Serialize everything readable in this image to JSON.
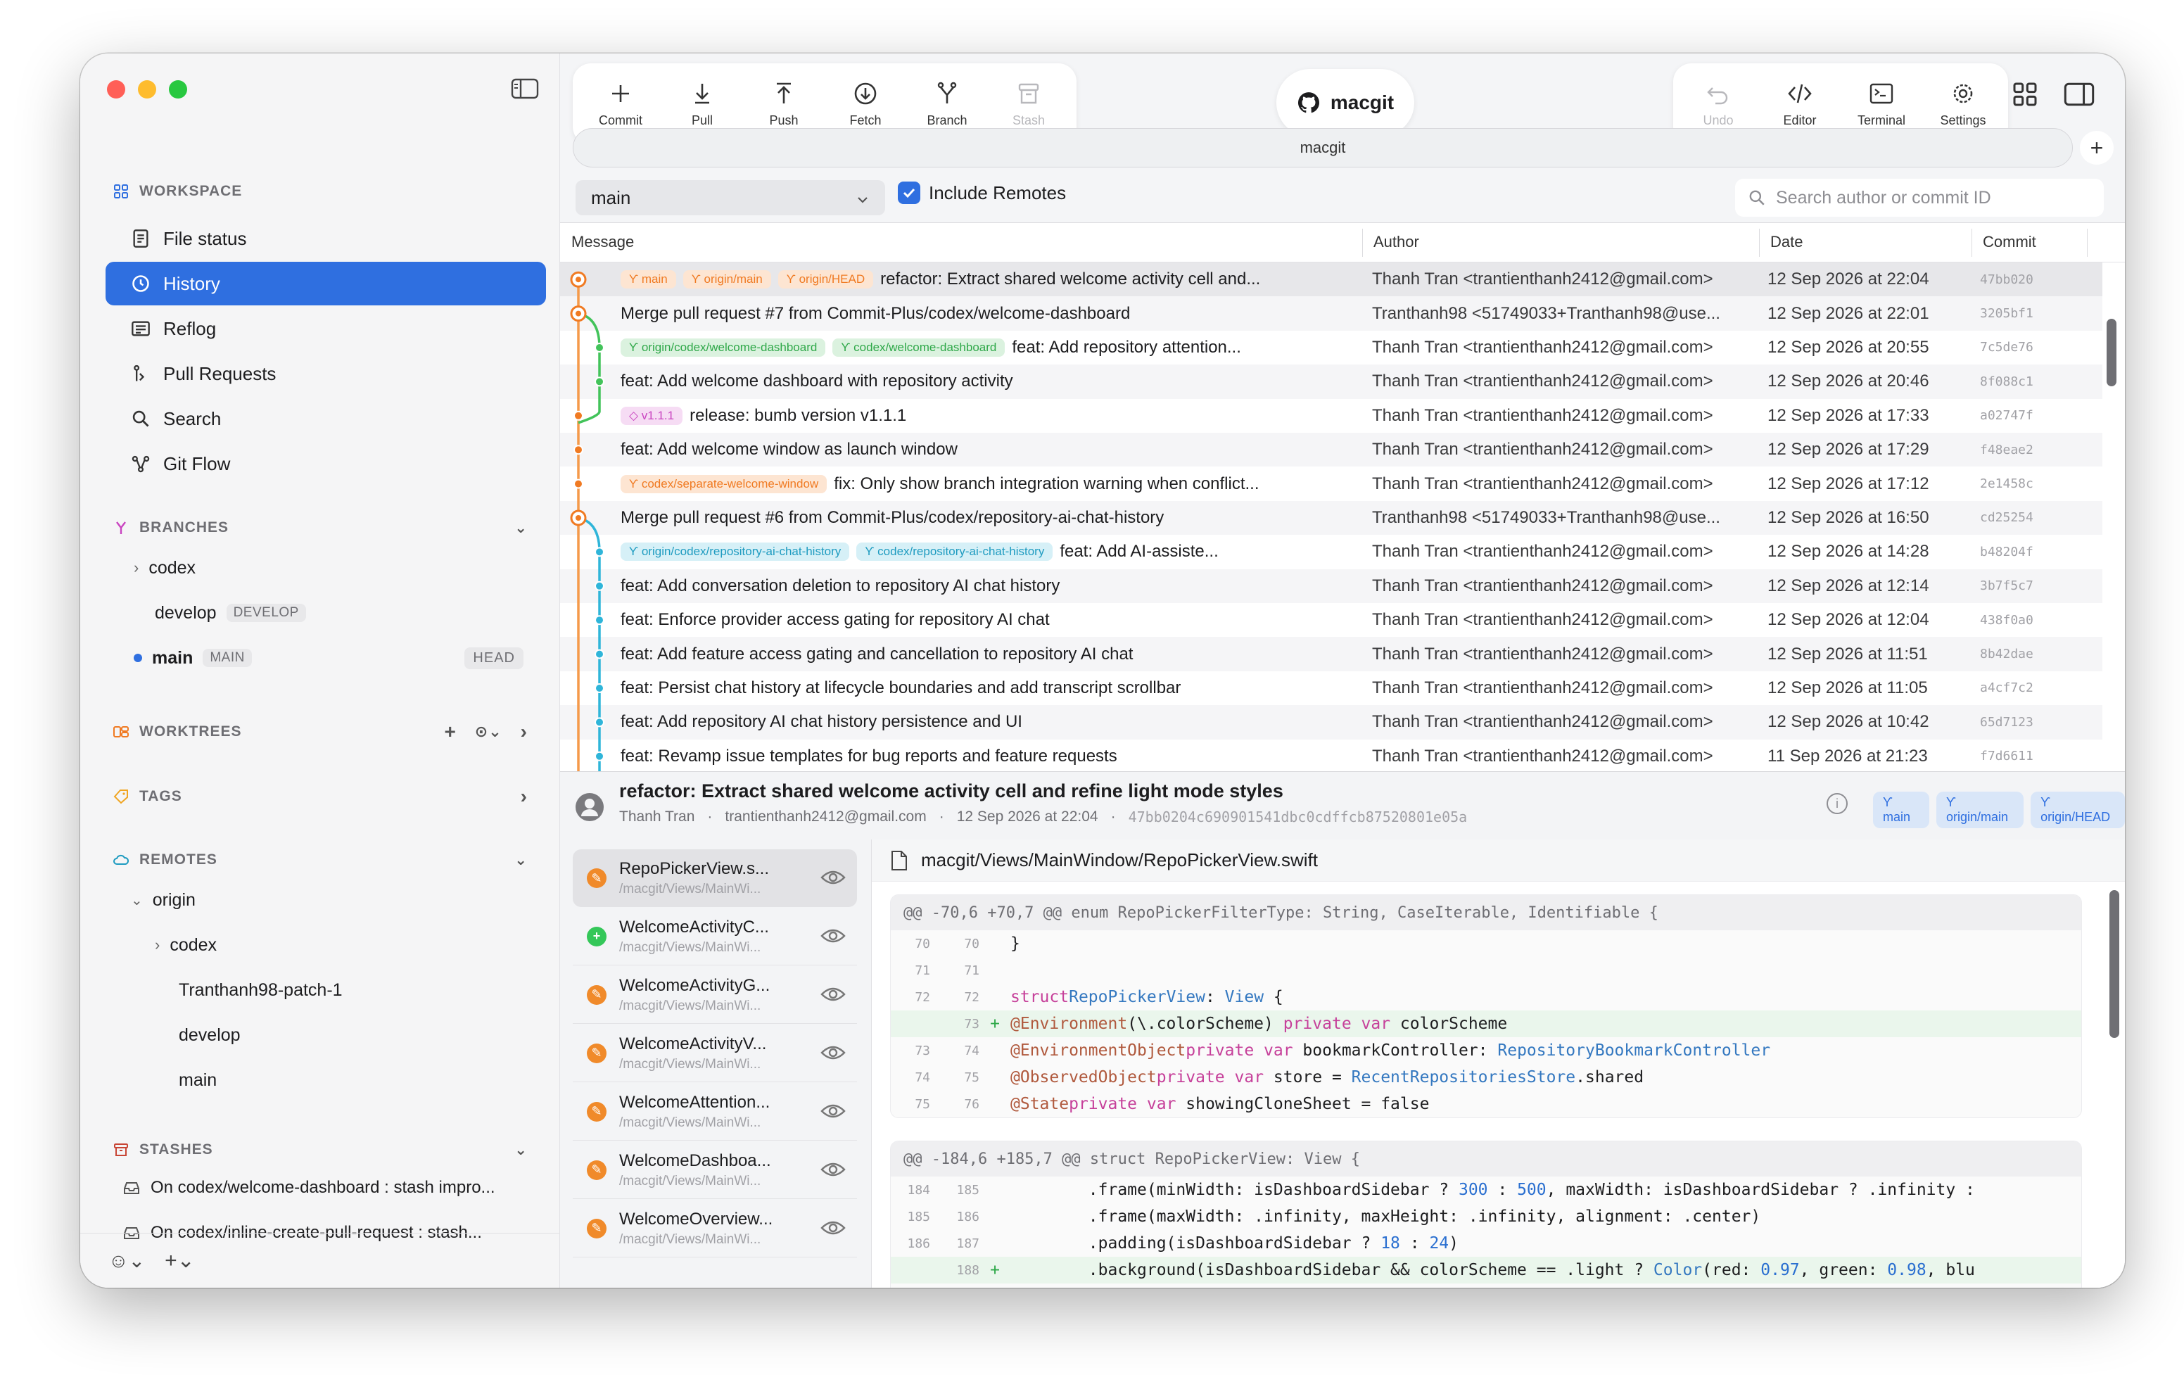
{
  "window": {
    "traffic_lights": [
      "#ff5f57",
      "#febc2e",
      "#28c840"
    ]
  },
  "sidebar": {
    "workspace_title": "WORKSPACE",
    "nav": [
      {
        "label": "File status",
        "icon": "file-status-icon"
      },
      {
        "label": "History",
        "icon": "clock-icon",
        "active": true
      },
      {
        "label": "Reflog",
        "icon": "reflog-icon"
      },
      {
        "label": "Pull Requests",
        "icon": "pull-request-icon"
      },
      {
        "label": "Search",
        "icon": "search-icon"
      },
      {
        "label": "Git Flow",
        "icon": "git-flow-icon"
      }
    ],
    "branches_title": "BRANCHES",
    "branches": [
      {
        "label": "codex",
        "collapsed": true
      },
      {
        "label": "develop",
        "badge": "DEVELOP"
      },
      {
        "label": "main",
        "badge": "MAIN",
        "tag": "HEAD",
        "current": true
      }
    ],
    "worktrees_title": "WORKTREES",
    "tags_title": "TAGS",
    "remotes_title": "REMOTES",
    "remotes": {
      "origin": "origin",
      "children": [
        "codex",
        "Tranthanh98-patch-1",
        "develop",
        "main"
      ]
    },
    "stashes_title": "STASHES",
    "stashes": [
      "On codex/welcome-dashboard : stash impro...",
      "On codex/inline-create-pull-request : stash..."
    ]
  },
  "toolbar": {
    "left": [
      {
        "label": "Commit",
        "icon": "plus-icon"
      },
      {
        "label": "Pull",
        "icon": "pull-icon"
      },
      {
        "label": "Push",
        "icon": "push-icon"
      },
      {
        "label": "Fetch",
        "icon": "fetch-icon"
      },
      {
        "label": "Branch",
        "icon": "branch-icon"
      },
      {
        "label": "Stash",
        "icon": "stash-icon",
        "disabled": true
      }
    ],
    "title": "macgit",
    "right": [
      {
        "label": "Undo",
        "icon": "undo-icon",
        "disabled": true
      },
      {
        "label": "Editor",
        "icon": "code-icon"
      },
      {
        "label": "Terminal",
        "icon": "terminal-icon"
      },
      {
        "label": "Settings",
        "icon": "gear-icon"
      }
    ],
    "tab_label": "macgit"
  },
  "filter": {
    "branch": "main",
    "include_remotes_label": "Include Remotes",
    "include_remotes": true,
    "search_placeholder": "Search author or commit ID"
  },
  "history": {
    "columns": [
      "Message",
      "Author",
      "Date",
      "Commit"
    ],
    "rows": [
      {
        "refs": [
          {
            "t": "main",
            "c": "orange"
          },
          {
            "t": "origin/main",
            "c": "orange"
          },
          {
            "t": "origin/HEAD",
            "c": "orange"
          }
        ],
        "message": "refactor: Extract shared welcome activity cell and...",
        "author": "Thanh Tran <trantienthanh2412@gmail.com>",
        "date": "12 Sep 2026 at 22:04",
        "hash": "47bb020",
        "selected": true
      },
      {
        "refs": [],
        "message": "Merge pull request #7 from Commit-Plus/codex/welcome-dashboard",
        "author": "Tranthanh98 <51749033+Tranthanh98@use...",
        "date": "12 Sep 2026 at 22:01",
        "hash": "3205bf1"
      },
      {
        "refs": [
          {
            "t": "origin/codex/welcome-dashboard",
            "c": "green"
          },
          {
            "t": "codex/welcome-dashboard",
            "c": "green"
          }
        ],
        "message": "feat: Add repository attention...",
        "author": "Thanh Tran <trantienthanh2412@gmail.com>",
        "date": "12 Sep 2026 at 20:55",
        "hash": "7c5de76"
      },
      {
        "refs": [],
        "message": "feat: Add welcome dashboard with repository activity",
        "author": "Thanh Tran <trantienthanh2412@gmail.com>",
        "date": "12 Sep 2026 at 20:46",
        "hash": "8f088c1"
      },
      {
        "refs": [
          {
            "t": "v1.1.1",
            "c": "pink"
          }
        ],
        "message": "release: bumb version v1.1.1",
        "author": "Thanh Tran <trantienthanh2412@gmail.com>",
        "date": "12 Sep 2026 at 17:33",
        "hash": "a02747f"
      },
      {
        "refs": [],
        "message": "feat: Add welcome window as launch window",
        "author": "Thanh Tran <trantienthanh2412@gmail.com>",
        "date": "12 Sep 2026 at 17:29",
        "hash": "f48eae2"
      },
      {
        "refs": [
          {
            "t": "codex/separate-welcome-window",
            "c": "orange"
          }
        ],
        "message": "fix: Only show branch integration warning when conflict...",
        "author": "Thanh Tran <trantienthanh2412@gmail.com>",
        "date": "12 Sep 2026 at 17:12",
        "hash": "2e1458c"
      },
      {
        "refs": [],
        "message": "Merge pull request #6 from Commit-Plus/codex/repository-ai-chat-history",
        "author": "Tranthanh98 <51749033+Tranthanh98@use...",
        "date": "12 Sep 2026 at 16:50",
        "hash": "cd25254"
      },
      {
        "refs": [
          {
            "t": "origin/codex/repository-ai-chat-history",
            "c": "cyan"
          },
          {
            "t": "codex/repository-ai-chat-history",
            "c": "cyan"
          }
        ],
        "message": "feat: Add AI-assiste...",
        "author": "Thanh Tran <trantienthanh2412@gmail.com>",
        "date": "12 Sep 2026 at 14:28",
        "hash": "b48204f"
      },
      {
        "refs": [],
        "message": "feat: Add conversation deletion to repository AI chat history",
        "author": "Thanh Tran <trantienthanh2412@gmail.com>",
        "date": "12 Sep 2026 at 12:14",
        "hash": "3b7f5c7"
      },
      {
        "refs": [],
        "message": "feat: Enforce provider access gating for repository AI chat",
        "author": "Thanh Tran <trantienthanh2412@gmail.com>",
        "date": "12 Sep 2026 at 12:04",
        "hash": "438f0a0"
      },
      {
        "refs": [],
        "message": "feat: Add feature access gating and cancellation to repository AI chat",
        "author": "Thanh Tran <trantienthanh2412@gmail.com>",
        "date": "12 Sep 2026 at 11:51",
        "hash": "8b42dae"
      },
      {
        "refs": [],
        "message": "feat: Persist chat history at lifecycle boundaries and add transcript scrollbar",
        "author": "Thanh Tran <trantienthanh2412@gmail.com>",
        "date": "12 Sep 2026 at 11:05",
        "hash": "a4cf7c2"
      },
      {
        "refs": [],
        "message": "feat: Add repository AI chat history persistence and UI",
        "author": "Thanh Tran <trantienthanh2412@gmail.com>",
        "date": "12 Sep 2026 at 10:42",
        "hash": "65d7123"
      },
      {
        "refs": [],
        "message": "feat: Revamp issue templates for bug reports and feature requests",
        "author": "Thanh Tran <trantienthanh2412@gmail.com>",
        "date": "11 Sep 2026 at 21:23",
        "hash": "f7d6611"
      }
    ]
  },
  "detail": {
    "title": "refactor: Extract shared welcome activity cell and refine light mode styles",
    "author": "Thanh Tran",
    "email": "trantienthanh2412@gmail.com",
    "date": "12 Sep 2026 at 22:04",
    "hash": "47bb0204c690901541dbc0cdffcb87520801e05a",
    "refs": [
      "main",
      "origin/main",
      "origin/HEAD"
    ],
    "files": [
      {
        "name": "RepoPickerView.s...",
        "path": "/macgit/Views/MainWi...",
        "status": "modified",
        "selected": true
      },
      {
        "name": "WelcomeActivityC...",
        "path": "/macgit/Views/MainWi...",
        "status": "added"
      },
      {
        "name": "WelcomeActivityG...",
        "path": "/macgit/Views/MainWi...",
        "status": "modified"
      },
      {
        "name": "WelcomeActivityV...",
        "path": "/macgit/Views/MainWi...",
        "status": "modified"
      },
      {
        "name": "WelcomeAttention...",
        "path": "/macgit/Views/MainWi...",
        "status": "modified"
      },
      {
        "name": "WelcomeDashboa...",
        "path": "/macgit/Views/MainWi...",
        "status": "modified"
      },
      {
        "name": "WelcomeOverview...",
        "path": "/macgit/Views/MainWi...",
        "status": "modified"
      }
    ],
    "diff_file": "macgit/Views/MainWindow/RepoPickerView.swift",
    "hunks": [
      {
        "header": "@@ -70,6 +70,7 @@ enum RepoPickerFilterType: String, CaseIterable, Identifiable {"
      },
      {
        "header": "@@ -184,6 +185,7 @@ struct RepoPickerView: View {"
      }
    ]
  }
}
